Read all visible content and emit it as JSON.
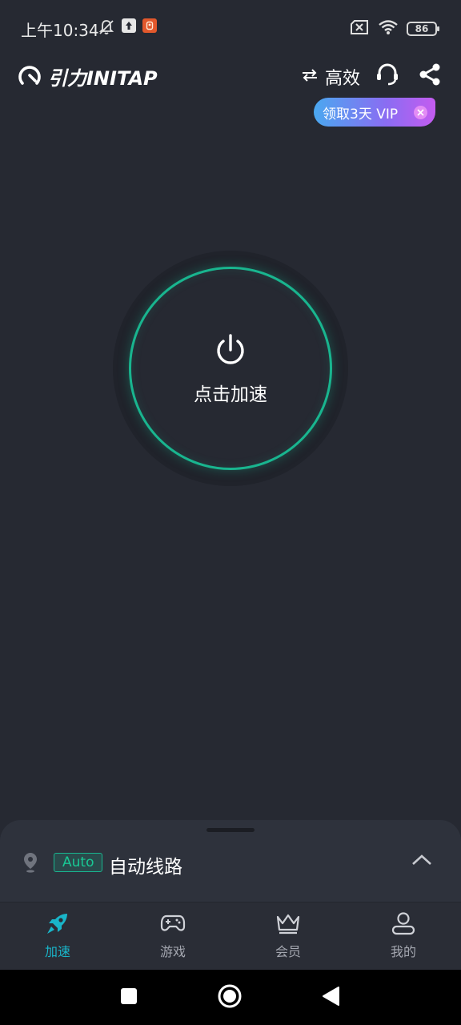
{
  "status_bar": {
    "time": "上午10:34",
    "battery": "86"
  },
  "header": {
    "logo_text": "引力INITAP",
    "mode_label": "高效"
  },
  "vip_banner": {
    "text": "领取3天 VIP"
  },
  "power_button": {
    "label": "点击加速"
  },
  "route": {
    "badge": "Auto",
    "name": "自动线路"
  },
  "bottom_nav": {
    "items": [
      {
        "label": "加速",
        "icon": "rocket-icon",
        "active": true
      },
      {
        "label": "游戏",
        "icon": "gamepad-icon",
        "active": false
      },
      {
        "label": "会员",
        "icon": "crown-icon",
        "active": false
      },
      {
        "label": "我的",
        "icon": "user-icon",
        "active": false
      }
    ]
  },
  "colors": {
    "background": "#262932",
    "accent_green": "#19b58f",
    "accent_cyan": "#19b5c9",
    "vip_gradient_start": "#4aa8f0",
    "vip_gradient_end": "#c45cf0"
  }
}
